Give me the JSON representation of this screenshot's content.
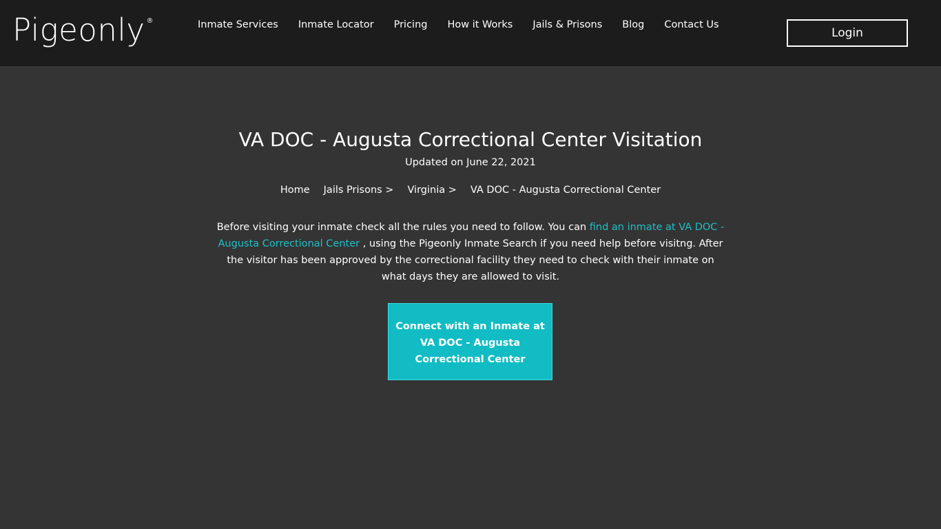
{
  "header": {
    "logo_text": "Pigeonly",
    "logo_mark": "®",
    "nav": [
      {
        "label": "Inmate Services"
      },
      {
        "label": "Inmate Locator"
      },
      {
        "label": "Pricing"
      },
      {
        "label": "How it Works"
      },
      {
        "label": "Jails & Prisons"
      },
      {
        "label": "Blog"
      },
      {
        "label": "Contact Us"
      }
    ],
    "login_label": "Login"
  },
  "page": {
    "title": "VA DOC - Augusta Correctional Center Visitation",
    "updated": "Updated on June 22, 2021",
    "breadcrumb": [
      "Home",
      "Jails Prisons >",
      "Virginia >",
      "VA DOC - Augusta Correctional Center"
    ],
    "intro": {
      "before_link": "Before visiting your inmate check all the rules you need to follow. You can ",
      "link_text": "find an inmate at VA DOC - Augusta Correctional Center",
      "after_link": " , using the Pigeonly Inmate Search if you need help before visitng. After the visitor has been approved by the correctional facility they need to check with their inmate on what days they are allowed to visit."
    },
    "cta_label": "Connect with an Inmate at VA DOC - Augusta Correctional Center"
  },
  "colors": {
    "header_bg": "#1c1c1c",
    "page_bg": "#343434",
    "accent": "#12bcc4",
    "link": "#1ec0c8"
  }
}
